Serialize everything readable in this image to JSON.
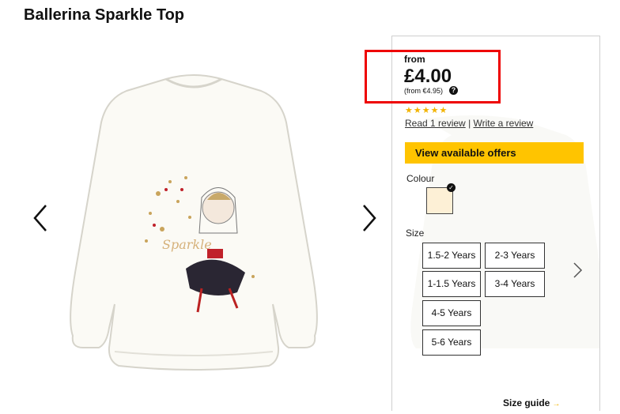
{
  "product": {
    "title": "Ballerina Sparkle Top"
  },
  "price": {
    "from_label": "from",
    "amount": "£4.00",
    "from_eur": "(from €4.95)",
    "help_glyph": "?"
  },
  "rating": {
    "stars": "★★★★★",
    "read_review": "Read 1 review",
    "separator": "|",
    "write_review": "Write a review"
  },
  "offers": {
    "label": "View available offers"
  },
  "colour": {
    "label": "Colour",
    "selected_swatch": "#fdf0d6",
    "check_glyph": "✓"
  },
  "size": {
    "label": "Size",
    "options": [
      "1.5-2 Years",
      "2-3 Years",
      "1-1.5 Years",
      "3-4 Years",
      "4-5 Years",
      "5-6 Years"
    ]
  },
  "size_guide": {
    "label": "Size guide",
    "arrow": "→"
  },
  "icons": {
    "prev": "chevron-left-icon",
    "next": "chevron-right-icon"
  }
}
